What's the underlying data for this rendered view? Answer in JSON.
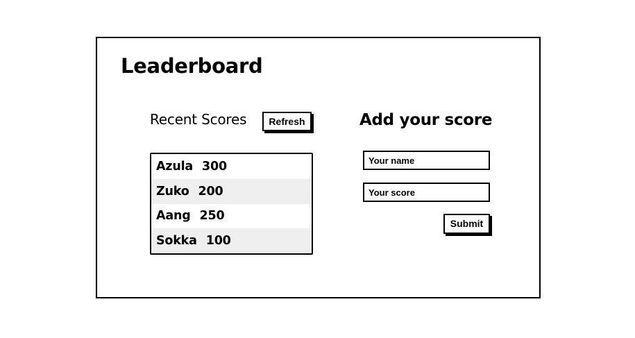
{
  "page": {
    "title": "Leaderboard"
  },
  "recent_scores": {
    "heading": "Recent Scores",
    "refresh_label": "Refresh",
    "rows": [
      {
        "name": "Azula",
        "score": "300"
      },
      {
        "name": "Zuko",
        "score": "200"
      },
      {
        "name": "Aang",
        "score": "250"
      },
      {
        "name": "Sokka",
        "score": "100"
      }
    ]
  },
  "add_score": {
    "heading": "Add your score",
    "name_placeholder": "Your name",
    "name_value": "",
    "score_placeholder": "Your score",
    "score_value": "",
    "submit_label": "Submit"
  },
  "colors": {
    "border": "#000000",
    "row_stripe": "#efefef",
    "background": "#ffffff"
  }
}
